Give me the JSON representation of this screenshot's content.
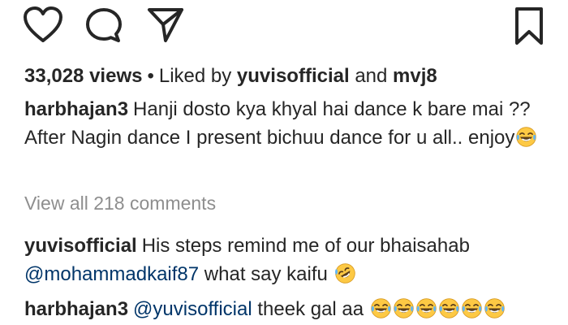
{
  "actions": {
    "like_icon": "heart-outline",
    "comment_icon": "comment-bubble",
    "share_icon": "paper-plane",
    "save_icon": "bookmark-outline"
  },
  "stats": {
    "views": "33,028 views",
    "liked_by_prefix": "Liked by",
    "liked_by_user": "yuvisofficial",
    "liked_by_and": "and",
    "liked_by_other": "mvj8"
  },
  "caption": {
    "username": "harbhajan3",
    "text": "Hanji dosto kya khyal hai dance k bare mai ?? After Nagin dance I present bichuu dance for u all.. enjoy",
    "emoji": "face-with-tears-of-joy"
  },
  "view_all_comments": "View all 218 comments",
  "comments": [
    {
      "username": "yuvisofficial",
      "text_1": "His steps remind me of our bhaisahab",
      "mention": "@mohammadkaif87",
      "text_2": "what say kaifu",
      "emoji": "rolling-on-floor-laughing"
    },
    {
      "username": "harbhajan3",
      "mention": "@yuvisofficial",
      "text": "theek gal aa",
      "emoji_count": 6,
      "emoji": "face-with-tears-of-joy"
    }
  ],
  "colors": {
    "text": "#262626",
    "secondary": "#8e8e8e",
    "mention": "#003569",
    "emoji_face": "#fdc944"
  }
}
